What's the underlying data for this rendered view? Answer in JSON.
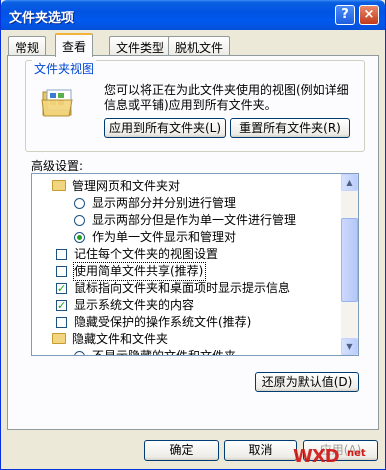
{
  "window": {
    "title": "文件夹选项",
    "help_glyph": "?",
    "close_glyph": "×"
  },
  "tabs": [
    {
      "label": "常规"
    },
    {
      "label": "查看"
    },
    {
      "label": "文件类型"
    },
    {
      "label": "脱机文件"
    }
  ],
  "folder_views": {
    "legend": "文件夹视图",
    "description": "您可以将正在为此文件夹使用的视图(例如详细信息或平铺)应用到所有文件夹。",
    "apply_all_button": "应用到所有文件夹(L)",
    "reset_all_button": "重置所有文件夹(R)"
  },
  "advanced": {
    "label": "高级设置:",
    "items": [
      {
        "type": "folder",
        "text": "管理网页和文件夹对"
      },
      {
        "type": "radio",
        "checked": false,
        "text": "显示两部分并分别进行管理"
      },
      {
        "type": "radio",
        "checked": false,
        "text": "显示两部分但是作为单一文件进行管理"
      },
      {
        "type": "radio",
        "checked": true,
        "text": "作为单一文件显示和管理对"
      },
      {
        "type": "checkbox",
        "checked": false,
        "text": "记住每个文件夹的视图设置"
      },
      {
        "type": "checkbox",
        "checked": false,
        "text": "使用简单文件共享(推荐)",
        "highlighted": true
      },
      {
        "type": "checkbox",
        "checked": true,
        "text": "鼠标指向文件夹和桌面项时显示提示信息"
      },
      {
        "type": "checkbox",
        "checked": true,
        "text": "显示系统文件夹的内容"
      },
      {
        "type": "checkbox",
        "checked": false,
        "text": "隐藏受保护的操作系统文件(推荐)"
      },
      {
        "type": "folder",
        "text": "隐藏文件和文件夹"
      },
      {
        "type": "radio",
        "checked": false,
        "text": "不显示隐藏的文件和文件夹"
      }
    ]
  },
  "restore_defaults_button": "还原为默认值(D)",
  "footer": {
    "ok": "确定",
    "cancel": "取消",
    "apply": "应用(A)"
  },
  "watermark": {
    "text": "WXD",
    "sub": "net"
  }
}
